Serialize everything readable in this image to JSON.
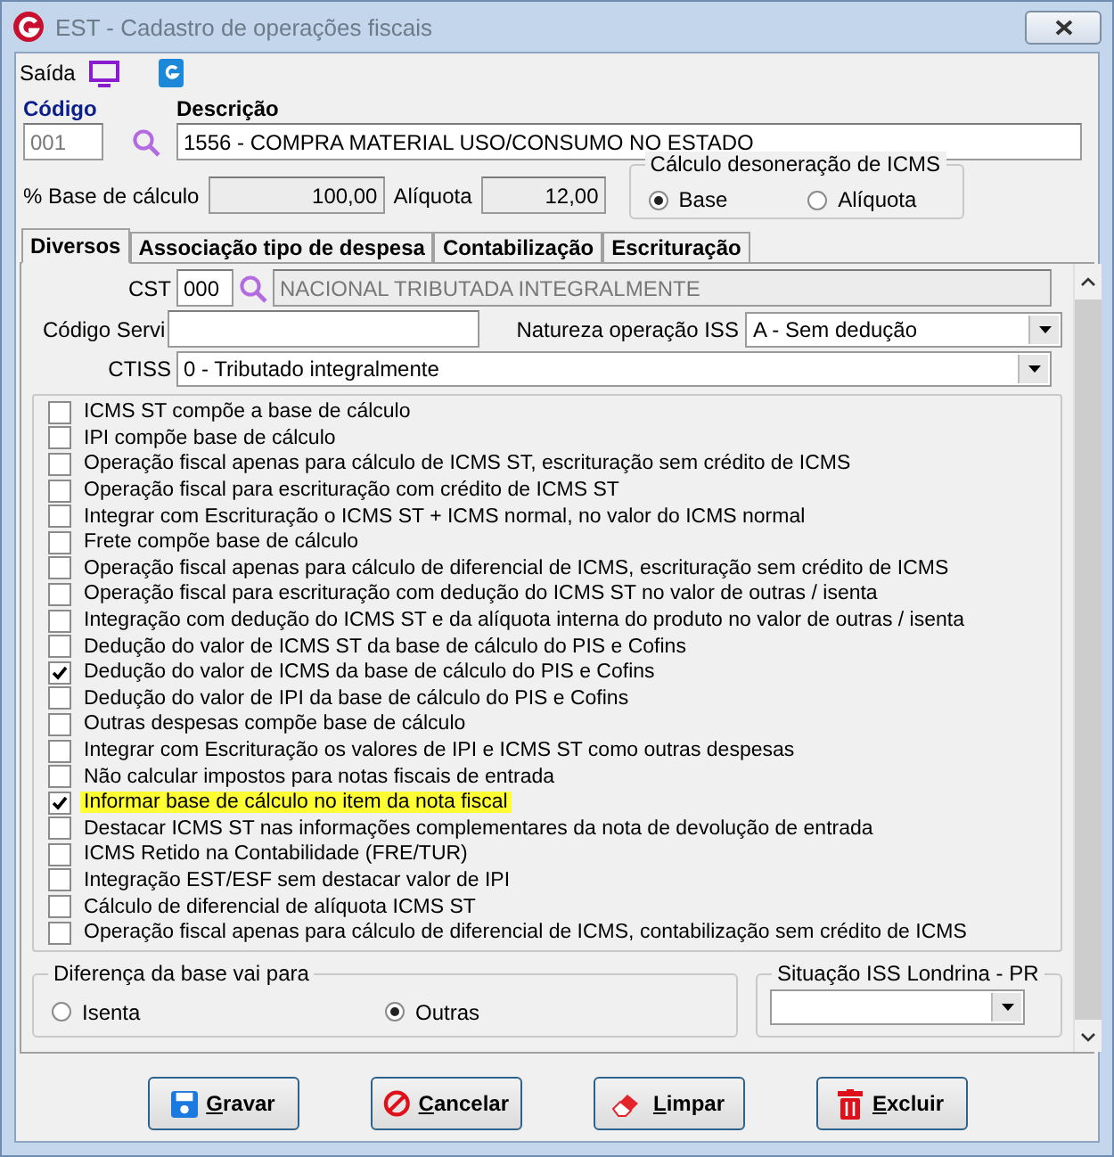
{
  "window": {
    "title": "EST - Cadastro de operações fiscais"
  },
  "toolbar": {
    "label": "Saída"
  },
  "codigo": {
    "label": "Código",
    "value": "001"
  },
  "descricao": {
    "label": "Descrição",
    "value": "1556 - COMPRA MATERIAL USO/CONSUMO NO ESTADO"
  },
  "base": {
    "label": "% Base de cálculo",
    "value": "100,00"
  },
  "aliquota": {
    "label": "Alíquota",
    "value": "12,00"
  },
  "desoneracao": {
    "title": "Cálculo desoneração de ICMS",
    "options": [
      {
        "label": "Base",
        "selected": true
      },
      {
        "label": "Alíquota",
        "selected": false
      }
    ]
  },
  "tabs": [
    {
      "label": "Diversos",
      "selected": true
    },
    {
      "label": "Associação tipo de despesa",
      "selected": false
    },
    {
      "label": "Contabilização",
      "selected": false
    },
    {
      "label": "Escrituração",
      "selected": false
    }
  ],
  "cst": {
    "label": "CST",
    "value": "000",
    "description": "NACIONAL TRIBUTADA INTEGRALMENTE"
  },
  "codigo_servico": {
    "label": "Código Servi"
  },
  "natureza": {
    "label": "Natureza operação ISS",
    "value": "A - Sem dedução"
  },
  "ctiss": {
    "label": "CTISS",
    "value": "0 - Tributado integralmente"
  },
  "options": [
    {
      "label": "ICMS ST compõe a base de cálculo",
      "checked": false,
      "highlighted": false
    },
    {
      "label": "IPI compõe base de cálculo",
      "checked": false,
      "highlighted": false
    },
    {
      "label": "Operação fiscal apenas para cálculo de ICMS ST, escrituração sem crédito de ICMS",
      "checked": false,
      "highlighted": false
    },
    {
      "label": "Operação fiscal para escrituração com crédito de ICMS ST",
      "checked": false,
      "highlighted": false
    },
    {
      "label": "Integrar com Escrituração o ICMS ST + ICMS normal,  no valor do ICMS normal",
      "checked": false,
      "highlighted": false
    },
    {
      "label": "Frete compõe base de cálculo",
      "checked": false,
      "highlighted": false
    },
    {
      "label": "Operação fiscal apenas para cálculo de diferencial de ICMS, escrituração sem crédito de ICMS",
      "checked": false,
      "highlighted": false
    },
    {
      "label": "Operação fiscal para escrituração com dedução do ICMS ST no valor de outras / isenta",
      "checked": false,
      "highlighted": false
    },
    {
      "label": "Integração com dedução do ICMS ST e da alíquota interna do produto no valor de outras / isenta",
      "checked": false,
      "highlighted": false
    },
    {
      "label": "Dedução do valor de ICMS ST da base de cálculo do PIS e Cofins",
      "checked": false,
      "highlighted": false
    },
    {
      "label": "Dedução do valor de ICMS da base de cálculo do PIS e Cofins",
      "checked": true,
      "highlighted": false
    },
    {
      "label": "Dedução do valor de IPI da base de cálculo do PIS e Cofins",
      "checked": false,
      "highlighted": false
    },
    {
      "label": "Outras despesas compõe base de cálculo",
      "checked": false,
      "highlighted": false
    },
    {
      "label": "Integrar com Escrituração os valores de IPI e ICMS ST como outras despesas",
      "checked": false,
      "highlighted": false
    },
    {
      "label": "Não calcular impostos para notas fiscais de entrada",
      "checked": false,
      "highlighted": false
    },
    {
      "label": "Informar base de cálculo no item da nota fiscal",
      "checked": true,
      "highlighted": true
    },
    {
      "label": "Destacar ICMS ST nas informações complementares da nota de devolução de entrada",
      "checked": false,
      "highlighted": false
    },
    {
      "label": "ICMS Retido na Contabilidade (FRE/TUR)",
      "checked": false,
      "highlighted": false
    },
    {
      "label": "Integração EST/ESF sem destacar valor de IPI",
      "checked": false,
      "highlighted": false
    },
    {
      "label": "Cálculo de diferencial de alíquota ICMS ST",
      "checked": false,
      "highlighted": false
    },
    {
      "label": "Operação fiscal apenas para cálculo de diferencial de ICMS, contabilização sem crédito de ICMS",
      "checked": false,
      "highlighted": false
    }
  ],
  "diferenca": {
    "title": "Diferença da base vai para",
    "options": [
      {
        "label": "Isenta",
        "selected": false
      },
      {
        "label": "Outras",
        "selected": true
      }
    ]
  },
  "situacao_iss": {
    "title": "Situação ISS Londrina - PR"
  },
  "buttons": [
    {
      "label": "Gravar",
      "kind": "save"
    },
    {
      "label": "Cancelar",
      "kind": "cancel"
    },
    {
      "label": "Limpar",
      "kind": "clear"
    },
    {
      "label": "Excluir",
      "kind": "delete"
    }
  ]
}
